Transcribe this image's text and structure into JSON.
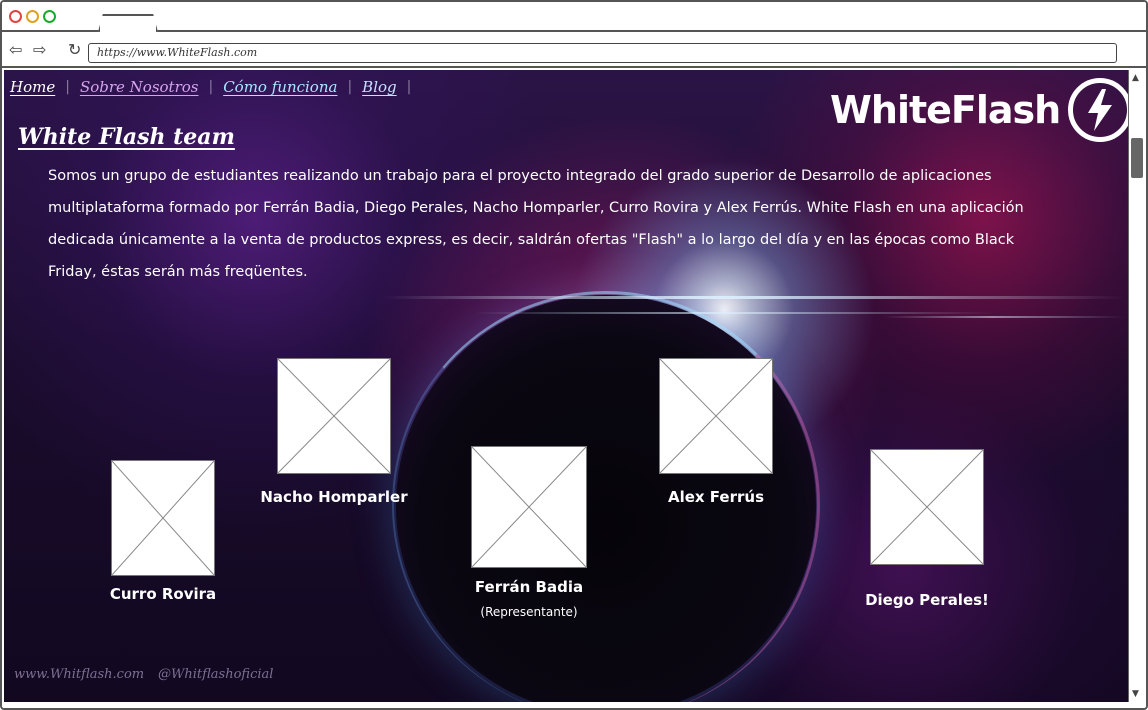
{
  "browser": {
    "url": "https://www.WhiteFlash.com",
    "icons": {
      "back": "arrow-left-icon",
      "forward": "arrow-right-icon",
      "reload": "reload-icon"
    }
  },
  "nav": {
    "home": "Home",
    "about": "Sobre Nosotros",
    "how": "Cómo funciona",
    "blog": "Blog",
    "separator": "|"
  },
  "logo": {
    "text": "WhiteFlash",
    "icon": "lightning-bolt-icon"
  },
  "team": {
    "title": "White Flash team",
    "intro": "Somos un grupo de estudiantes realizando un trabajo para el proyecto integrado del grado superior de Desarrollo de aplicaciones multiplataforma formado por Ferrán Badia, Diego Perales, Nacho Homparler, Curro Rovira y Alex Ferrús. White Flash en una aplicación dedicada únicamente a la venta de productos express, es decir, saldrán ofertas \"Flash\" a lo largo del día y en las épocas como Black Friday, éstas serán más freqüentes."
  },
  "members": [
    {
      "name": "Curro Rovira"
    },
    {
      "name": "Nacho Homparler"
    },
    {
      "name": "Ferrán Badia",
      "role": "(Representante)"
    },
    {
      "name": "Alex Ferrús"
    },
    {
      "name": "Diego Perales!"
    }
  ],
  "footer": {
    "website": "www.Whitflash.com",
    "handle": "@Whitflashoficial"
  },
  "colors": {
    "nav_home": "#ffffff",
    "nav_about": "#d6a4ee",
    "nav_how": "#a8e6ff",
    "nav_blog": "#c8e0ff",
    "background": "#1a0c2c"
  }
}
